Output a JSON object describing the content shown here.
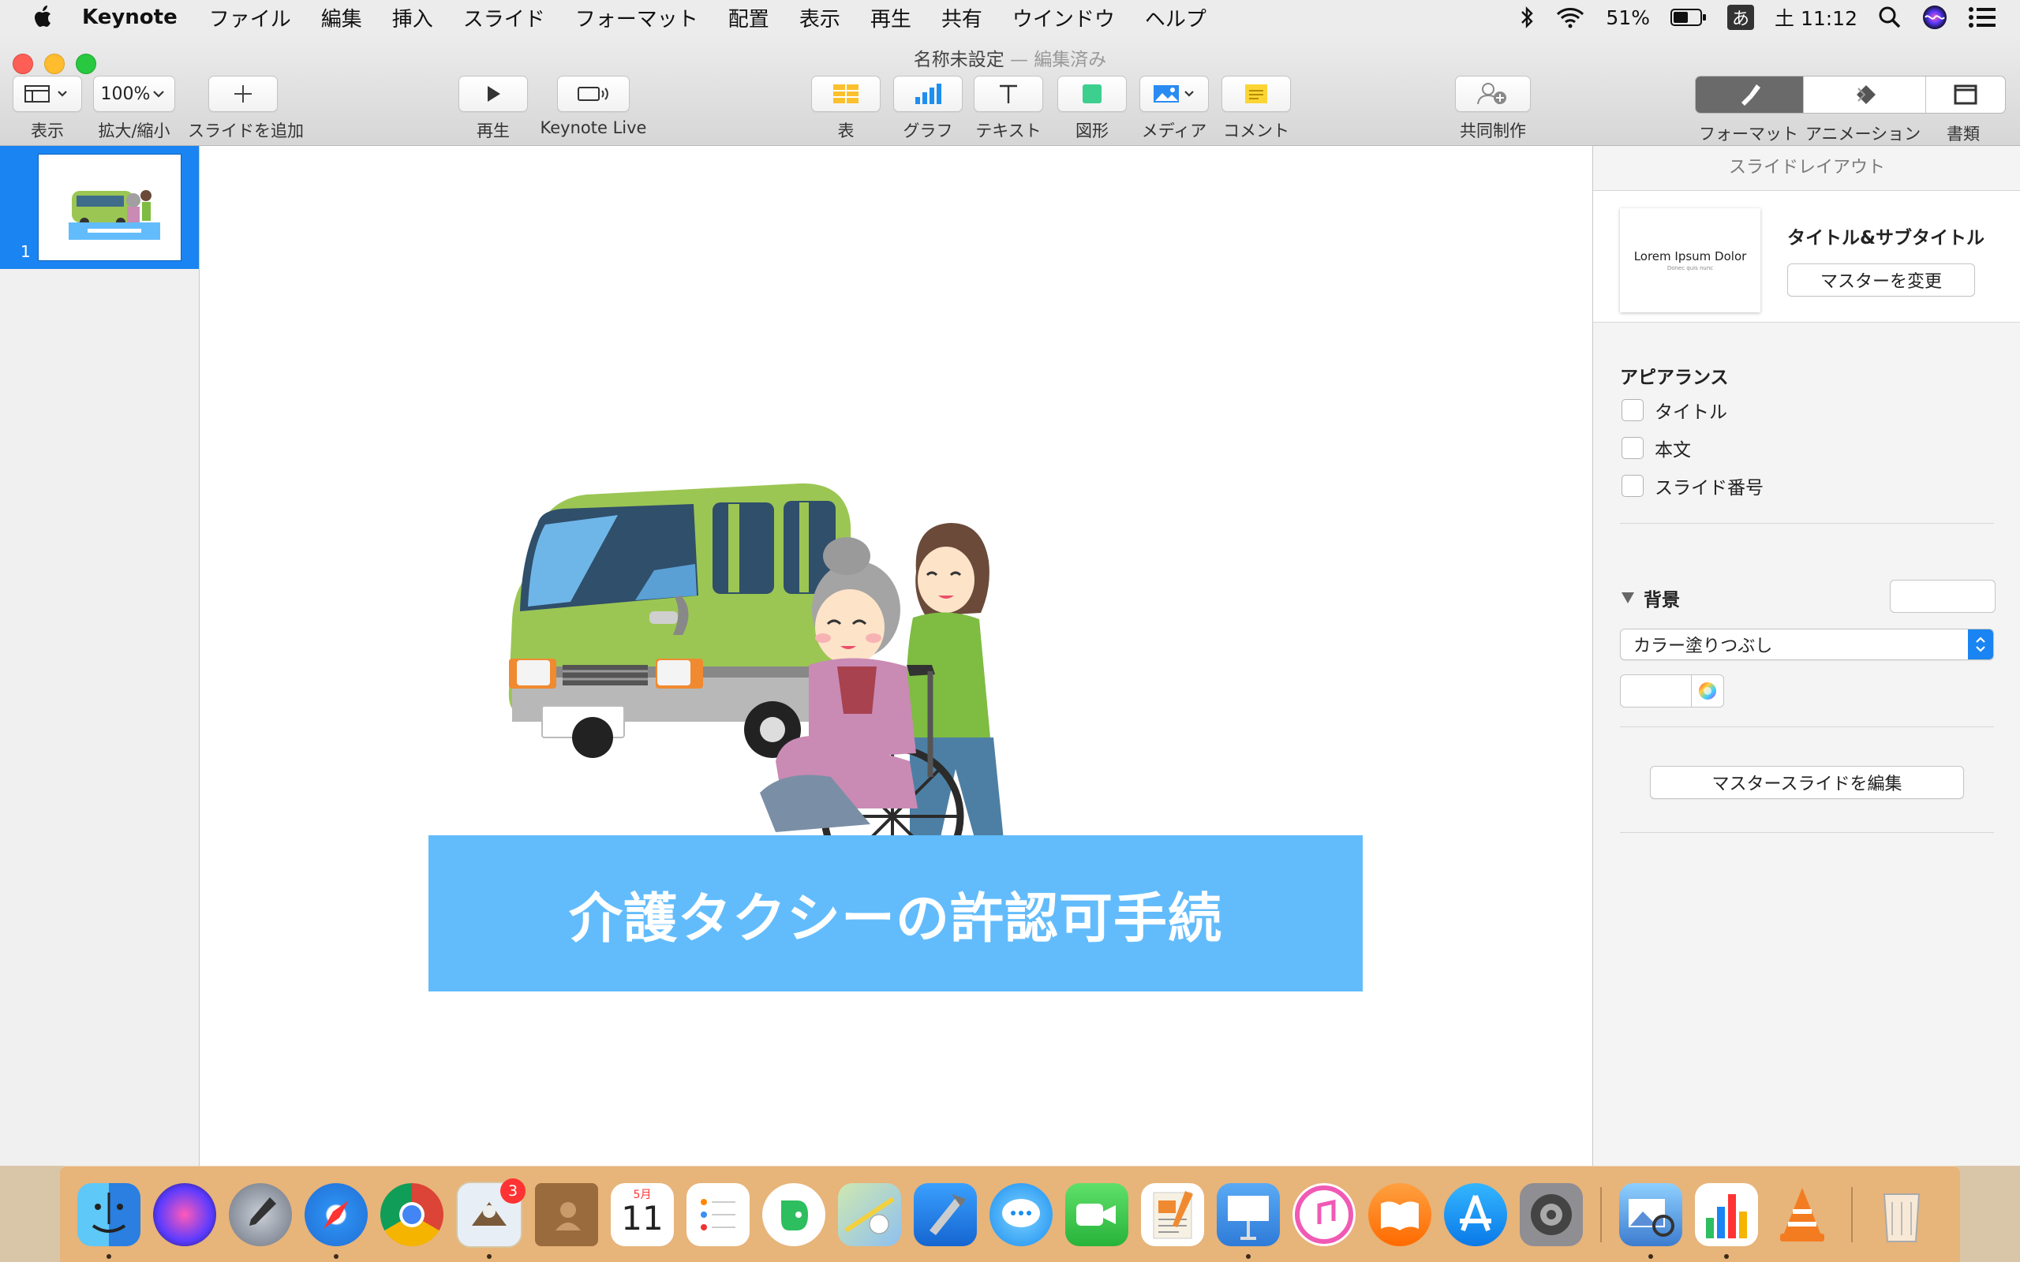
{
  "menubar": {
    "app_name": "Keynote",
    "items": [
      "ファイル",
      "編集",
      "挿入",
      "スライド",
      "フォーマット",
      "配置",
      "表示",
      "再生",
      "共有",
      "ウインドウ",
      "ヘルプ"
    ],
    "battery": "51%",
    "ime": "あ",
    "clock": "土 11:12"
  },
  "window": {
    "title": "名称未設定",
    "edited_suffix": "— 編集済み"
  },
  "toolbar": {
    "view_label": "表示",
    "zoom_value": "100%",
    "zoom_label": "拡大/縮小",
    "add_slide_label": "スライドを追加",
    "play_label": "再生",
    "live_label": "Keynote Live",
    "table_label": "表",
    "chart_label": "グラフ",
    "text_label": "テキスト",
    "shape_label": "図形",
    "media_label": "メディア",
    "comment_label": "コメント",
    "collab_label": "共同制作",
    "format_label": "フォーマット",
    "animate_label": "アニメーション",
    "document_label": "書類"
  },
  "navigator": {
    "slides": [
      {
        "number": "1"
      }
    ]
  },
  "slide": {
    "caption": "介護タクシーの許認可手続"
  },
  "inspector": {
    "header": "スライドレイアウト",
    "layout_preview_title": "Lorem Ipsum Dolor",
    "layout_preview_sub": "Donec quis nunc",
    "layout_name": "タイトル&サブタイトル",
    "change_master": "マスターを変更",
    "appearance_title": "アピアランス",
    "checkboxes": [
      "タイトル",
      "本文",
      "スライド番号"
    ],
    "background_title": "背景",
    "fill_type": "カラー塗りつぶし",
    "edit_master": "マスタースライドを編集"
  },
  "dock": {
    "mail_badge": "3",
    "calendar_month": "5月",
    "calendar_day": "11"
  },
  "colors": {
    "accent": "#1a84f2",
    "caption_bg": "#62bcfc",
    "bus_green": "#9cc653"
  }
}
